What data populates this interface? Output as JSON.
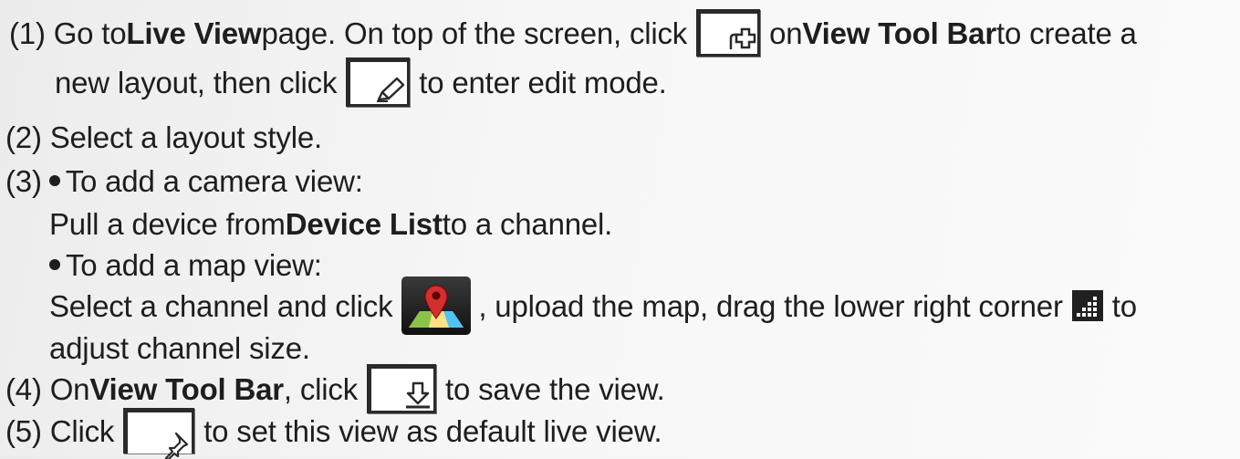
{
  "steps": {
    "s1": {
      "a": "(1) Go to ",
      "b": "Live View",
      "c": " page. On top of the screen, click",
      "d": "on ",
      "e": "View Tool Bar",
      "f": " to create a",
      "g": "new layout, then click",
      "h": "to enter edit mode."
    },
    "s2": {
      "a": "(2) Select a layout style."
    },
    "s3": {
      "num": "(3)",
      "a": "To add a camera view:",
      "b": "Pull a device from ",
      "c": "Device List",
      "d": " to a channel.",
      "e": "To add a map view:",
      "f": "Select a channel and click",
      "g": ", upload the map, drag the lower right corner",
      "h": "to",
      "i": "adjust channel size."
    },
    "s4": {
      "a": "(4) On ",
      "b": "View Tool Bar",
      "c": ", click",
      "d": "to save the view."
    },
    "s5": {
      "a": "(5) Click",
      "b": "to set this view as default live view."
    }
  },
  "icons": {
    "new_layout": "new-layout-plus-icon",
    "edit": "edit-pencil-icon",
    "map": "map-pin-icon",
    "resize_corner": "resize-corner-icon",
    "save": "save-download-icon",
    "set_default": "set-default-pin-icon"
  }
}
